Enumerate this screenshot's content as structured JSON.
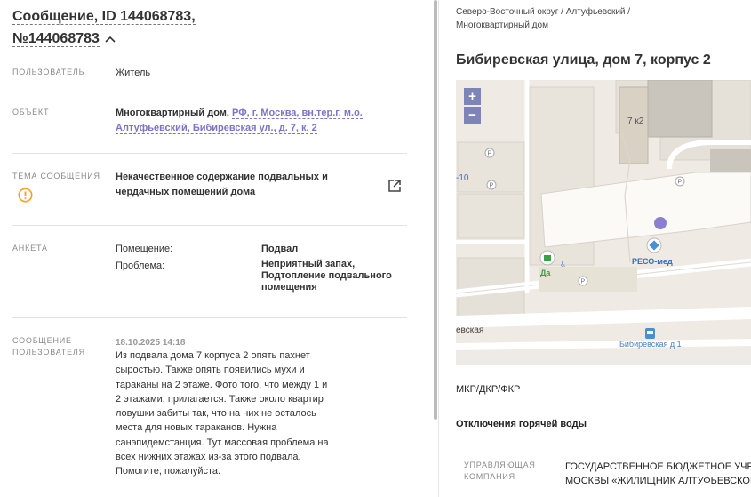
{
  "header": {
    "title_line1": "Сообщение, ID 144068783,",
    "title_line2": "№144068783"
  },
  "fields": {
    "user": {
      "label": "ПОЛЬЗОВАТЕЛЬ",
      "value": "Житель"
    },
    "object": {
      "label": "ОБЪЕКТ",
      "type": "Многоквартирный дом,",
      "address_line1": "РФ, г. Москва, вн.тер.г. м.о.",
      "address_line2": "Алтуфьевский, Бибиревская ул., д. 7, к. 2"
    },
    "topic": {
      "label": "ТЕМА СООБЩЕНИЯ",
      "value_line1": "Некачественное содержание подвальных и",
      "value_line2": "чердачных помещений дома"
    },
    "survey": {
      "label": "АНКЕТА",
      "rows": [
        {
          "key": "Помещение:",
          "value": [
            "Подвал"
          ]
        },
        {
          "key": "Проблема:",
          "value": [
            "Неприятный запах,",
            "Подтопление подвального",
            "помещения"
          ]
        }
      ]
    },
    "message": {
      "label_line1": "СООБЩЕНИЕ",
      "label_line2": "ПОЛЬЗОВАТЕЛЯ",
      "date": "18.10.2025 14:18",
      "lines": [
        "Из подвала дома 7 корпуса 2 опять пахнет",
        "сыростью. Также опять появились мухи и",
        "тараканы на 2 этаже. Фото того, что между 1 и",
        "2 этажами, прилагается. Также около квартир",
        "ловушки забиты так, что на них не осталось",
        "места для новых тараканов. Нужна",
        "санэпидемстанция. Тут массовая проблема на",
        "всех нижних этажах из-за этого подвала.",
        "Помогите, пожалуйста."
      ]
    }
  },
  "right": {
    "breadcrumb_line1": "Северо-Восточный округ / Алтуфьевский /",
    "breadcrumb_line2": "Многоквартирный дом",
    "address": "Бибиревская улица, дом 7, корпус 2",
    "map": {
      "zoom_in": "+",
      "zoom_out": "−",
      "labels": {
        "building": "7 к2",
        "poi_reso": "РЕСО-мед",
        "poi_da": "Да",
        "street": "евская",
        "bus_stop": "Бибиревская д 1",
        "edge_num": "-10",
        "parking": "P"
      }
    },
    "mkr": "МКР/ДКР/ФКР",
    "hot_water": "Отключения горячей воды",
    "management": {
      "label_line1": "УПРАВЛЯЮЩАЯ",
      "label_line2": "КОМПАНИЯ",
      "value_line1": "ГОСУДАРСТВЕННОЕ БЮДЖЕТНОЕ УЧРЕЖ",
      "value_line2": "МОСКВЫ «ЖИЛИЩНИК АЛТУФЬЕВСКОГО"
    }
  },
  "colors": {
    "accent": "#7b74c9",
    "warning": "#f2a020",
    "map_bg": "#efeae3",
    "marker": "#8b7fd0"
  }
}
